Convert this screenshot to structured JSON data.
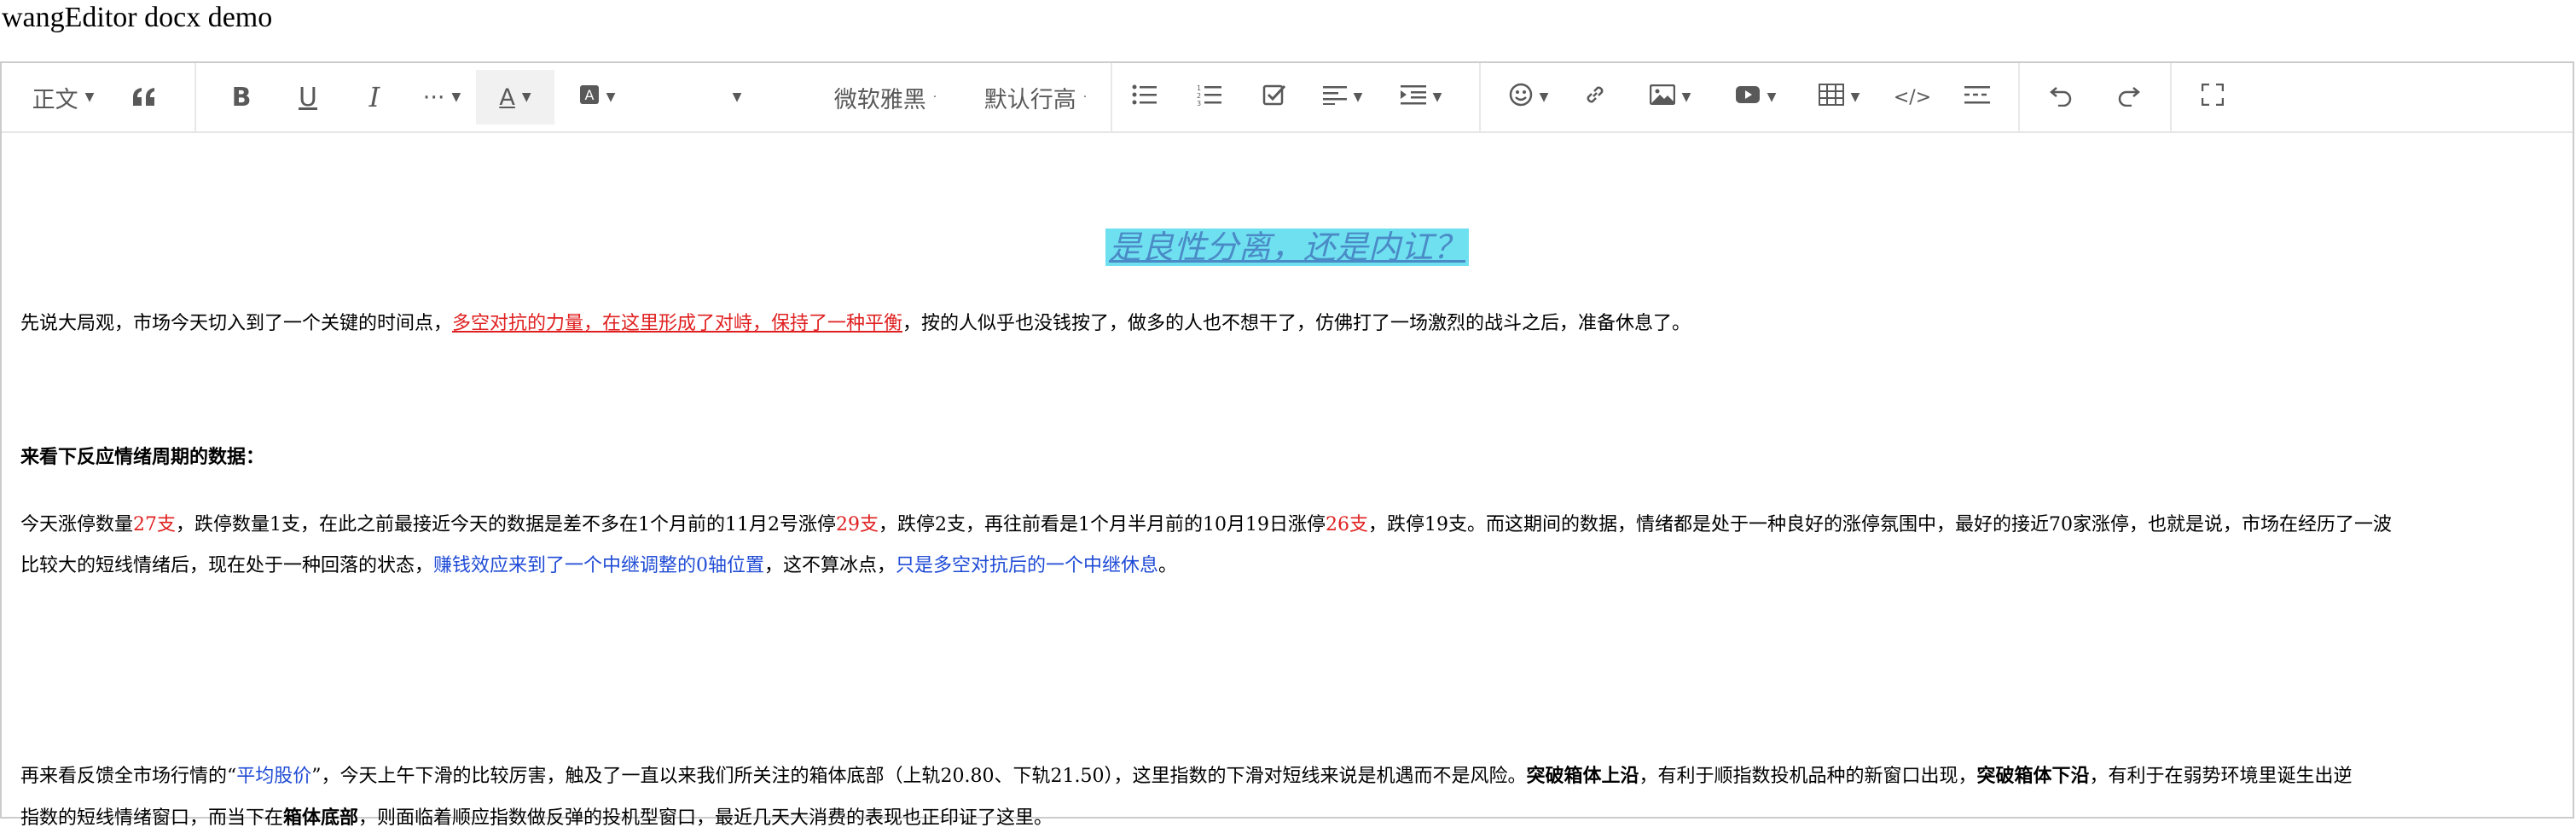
{
  "page": {
    "title": "wangEditor docx demo"
  },
  "toolbar": {
    "heading": "正文",
    "font_family": "微软雅黑",
    "line_height": "默认行高",
    "tools": [
      {
        "name": "quote-icon",
        "glyph": "❝"
      },
      {
        "name": "bold-icon",
        "glyph": "B"
      },
      {
        "name": "underline-icon",
        "glyph": "U"
      },
      {
        "name": "italic-icon",
        "glyph": "I"
      },
      {
        "name": "more-icon",
        "glyph": "···"
      }
    ]
  },
  "doc": {
    "headline": "是良性分离，还是内讧？",
    "p1": {
      "a": "先说大局观，市场今天切入到了一个关键的时间点，",
      "b": "多空对抗的力量，在这里形成了对峙，保持了一种平衡",
      "c": "，按的人似乎也没钱按了，做多的人也不想干了，仿佛打了一场激烈的战斗之后，准备休息了。"
    },
    "p2": "来看下反应情绪周期的数据：",
    "p3": {
      "a": "今天涨停数量",
      "b": "27支",
      "c": "，跌停数量1支，在此之前最接近今天的数据是差不多在1个月前的11月2号涨停",
      "d": "29支",
      "e": "，跌停2支，再往前看是1个月半月前的10月19日涨停",
      "f": "26支",
      "g": "，跌停19支。而这期间的数据，情绪都是处于一种良好的涨停氛围中，最好的接近70家涨停，也就是说，市场在经历了一波",
      "h": "比较大的短线情绪后，现在处于一种回落的状态，",
      "i": "赚钱效应来到了一个中继调整的0轴位置",
      "j": "，这不算冰点，",
      "k": "只是多空对抗后的一个中继休息",
      "l": "。"
    },
    "p4": {
      "a": "再来看反馈全市场行情的“",
      "b": "平均股价",
      "c": "”，今天上午下滑的比较厉害，触及了一直以来我们所关注的箱体底部（上轨20.80、下轨21.50），这里指数的下滑对短线来说是机遇而不是风险。",
      "d": "突破箱体上沿",
      "e": "，有利于顺指数投机品种的新窗口出现，",
      "f": "突破箱体下沿",
      "g": "，有利于在弱势环境里诞生出逆",
      "h": "指数的短线情绪窗口，而当下在",
      "i": "箱体底部",
      "j": "，则面临着顺应指数做反弹的投机型窗口，最近几天大消费的表现也正印证了这里。"
    }
  },
  "colors": {
    "accent_red": "#e02020",
    "accent_blue": "#1f4bd6",
    "headline_bg": "#6fe0f0",
    "headline_fg": "#4a8ac6"
  }
}
